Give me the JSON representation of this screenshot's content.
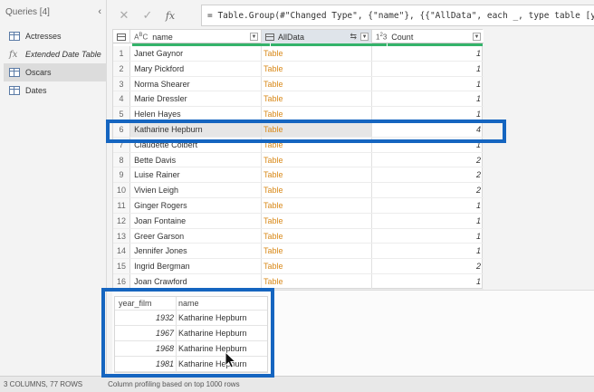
{
  "queries": {
    "title": "Queries [4]",
    "collapse_icon": "chevron-left-icon",
    "items": [
      {
        "label": "Actresses",
        "icon": "table-icon",
        "italic": false,
        "selected": false
      },
      {
        "label": "Extended Date Table",
        "icon": "function-icon",
        "italic": true,
        "selected": false
      },
      {
        "label": "Oscars",
        "icon": "table-icon",
        "italic": false,
        "selected": true
      },
      {
        "label": "Dates",
        "icon": "table-icon",
        "italic": false,
        "selected": false
      }
    ]
  },
  "formula_bar": {
    "cancel_glyph": "✕",
    "confirm_glyph": "✓",
    "fx_glyph": "fx",
    "formula": "= Table.Group(#\"Changed Type\", {\"name\"}, {{\"AllData\", each _, type table [year_fil"
  },
  "grid": {
    "corner_icon": "table-menu-icon",
    "columns": [
      {
        "label": "name",
        "type_glyph": "ABC"
      },
      {
        "label": "AllData",
        "type_glyph": "table"
      },
      {
        "label": "Count",
        "type_glyph": "123"
      }
    ],
    "rows": [
      {
        "num": "1",
        "name": "Janet Gaynor",
        "alldata": "Table",
        "count": "1"
      },
      {
        "num": "2",
        "name": "Mary Pickford",
        "alldata": "Table",
        "count": "1"
      },
      {
        "num": "3",
        "name": "Norma Shearer",
        "alldata": "Table",
        "count": "1"
      },
      {
        "num": "4",
        "name": "Marie Dressler",
        "alldata": "Table",
        "count": "1"
      },
      {
        "num": "5",
        "name": "Helen Hayes",
        "alldata": "Table",
        "count": "1"
      },
      {
        "num": "6",
        "name": "Katharine Hepburn",
        "alldata": "Table",
        "count": "4"
      },
      {
        "num": "7",
        "name": "Claudette Colbert",
        "alldata": "Table",
        "count": "1"
      },
      {
        "num": "8",
        "name": "Bette Davis",
        "alldata": "Table",
        "count": "2"
      },
      {
        "num": "9",
        "name": "Luise Rainer",
        "alldata": "Table",
        "count": "2"
      },
      {
        "num": "10",
        "name": "Vivien Leigh",
        "alldata": "Table",
        "count": "2"
      },
      {
        "num": "11",
        "name": "Ginger Rogers",
        "alldata": "Table",
        "count": "1"
      },
      {
        "num": "12",
        "name": "Joan Fontaine",
        "alldata": "Table",
        "count": "1"
      },
      {
        "num": "13",
        "name": "Greer Garson",
        "alldata": "Table",
        "count": "1"
      },
      {
        "num": "14",
        "name": "Jennifer Jones",
        "alldata": "Table",
        "count": "1"
      },
      {
        "num": "15",
        "name": "Ingrid Bergman",
        "alldata": "Table",
        "count": "2"
      },
      {
        "num": "16",
        "name": "Joan Crawford",
        "alldata": "Table",
        "count": "1"
      }
    ],
    "selected_row": "6"
  },
  "preview": {
    "headers": [
      "year_film",
      "name"
    ],
    "rows": [
      {
        "year": "1932",
        "name": "Katharine Hepburn"
      },
      {
        "year": "1967",
        "name": "Katharine Hepburn"
      },
      {
        "year": "1968",
        "name": "Katharine Hepburn"
      },
      {
        "year": "1981",
        "name": "Katharine Hepburn"
      }
    ]
  },
  "status": {
    "summary": "3 COLUMNS, 77 ROWS",
    "profiling": "Column profiling based on top 1000 rows"
  },
  "colors": {
    "highlight": "#1565c0",
    "table_link": "#d98a1a",
    "quality_bar": "#34b36a"
  }
}
